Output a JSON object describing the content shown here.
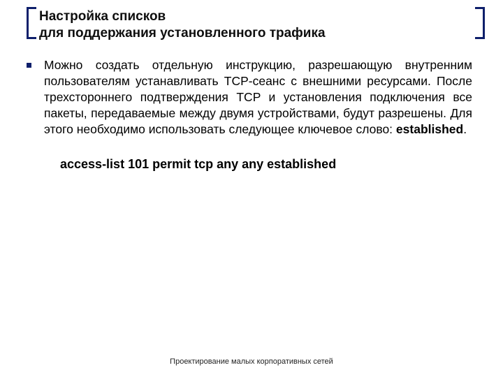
{
  "title": {
    "line1": "Настройка списков",
    "line2": "для поддержания установленного трафика"
  },
  "body": {
    "paragraph_pre": "Можно создать отдельную инструкцию, разрешающую внутренним пользователям устанавливать TCP-сеанс с внешними ресурсами. После трехстороннего подтверждения TCP и установления подключения все пакеты, передаваемые между двумя устройствами, будут разрешены. Для этого необходимо использовать следующее ключевое слово: ",
    "keyword": "established",
    "suffix": ".",
    "command": "access-list 101 permit tcp any any established"
  },
  "footer": "Проектирование малых корпоративных сетей"
}
